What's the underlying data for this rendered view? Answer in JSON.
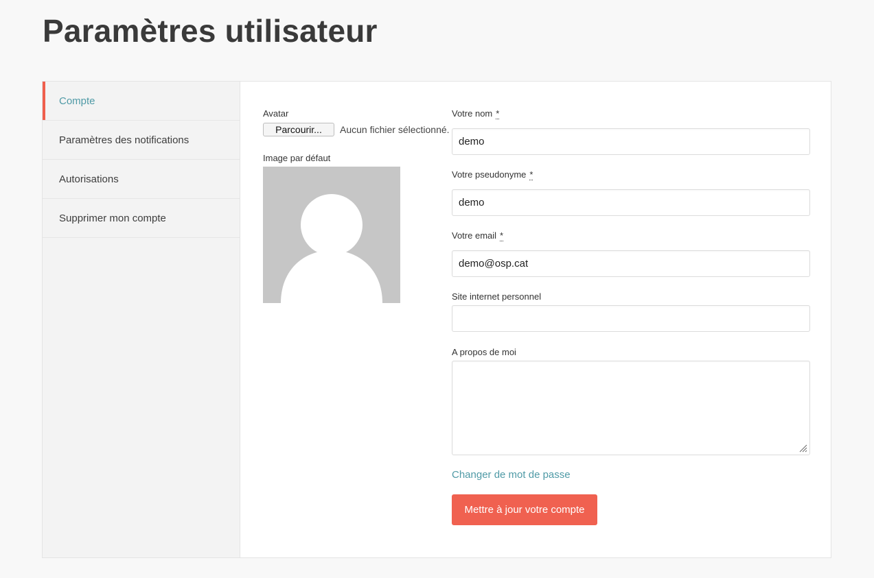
{
  "page": {
    "title": "Paramètres utilisateur"
  },
  "sidebar": {
    "items": [
      {
        "label": "Compte",
        "active": true
      },
      {
        "label": "Paramètres des notifications",
        "active": false
      },
      {
        "label": "Autorisations",
        "active": false
      },
      {
        "label": "Supprimer mon compte",
        "active": false
      }
    ]
  },
  "avatar": {
    "label": "Avatar",
    "browse_button": "Parcourir...",
    "file_status": "Aucun fichier sélectionné.",
    "default_label": "Image par défaut"
  },
  "form": {
    "name": {
      "label": "Votre nom",
      "required_marker": "*",
      "value": "demo"
    },
    "nickname": {
      "label": "Votre pseudonyme",
      "required_marker": "*",
      "value": "demo"
    },
    "email": {
      "label": "Votre email",
      "required_marker": "*",
      "value": "demo@osp.cat"
    },
    "website": {
      "label": "Site internet personnel",
      "value": ""
    },
    "about": {
      "label": "A propos de moi",
      "value": ""
    },
    "change_password_link": "Changer de mot de passe",
    "submit_label": "Mettre à jour votre compte"
  },
  "colors": {
    "accent": "#ef5f4d",
    "link": "#4f9aa6",
    "avatar_bg": "#c6c6c6"
  },
  "icons": {
    "resize_handle": "resize-grip-icon",
    "default_avatar": "user-silhouette-icon"
  }
}
